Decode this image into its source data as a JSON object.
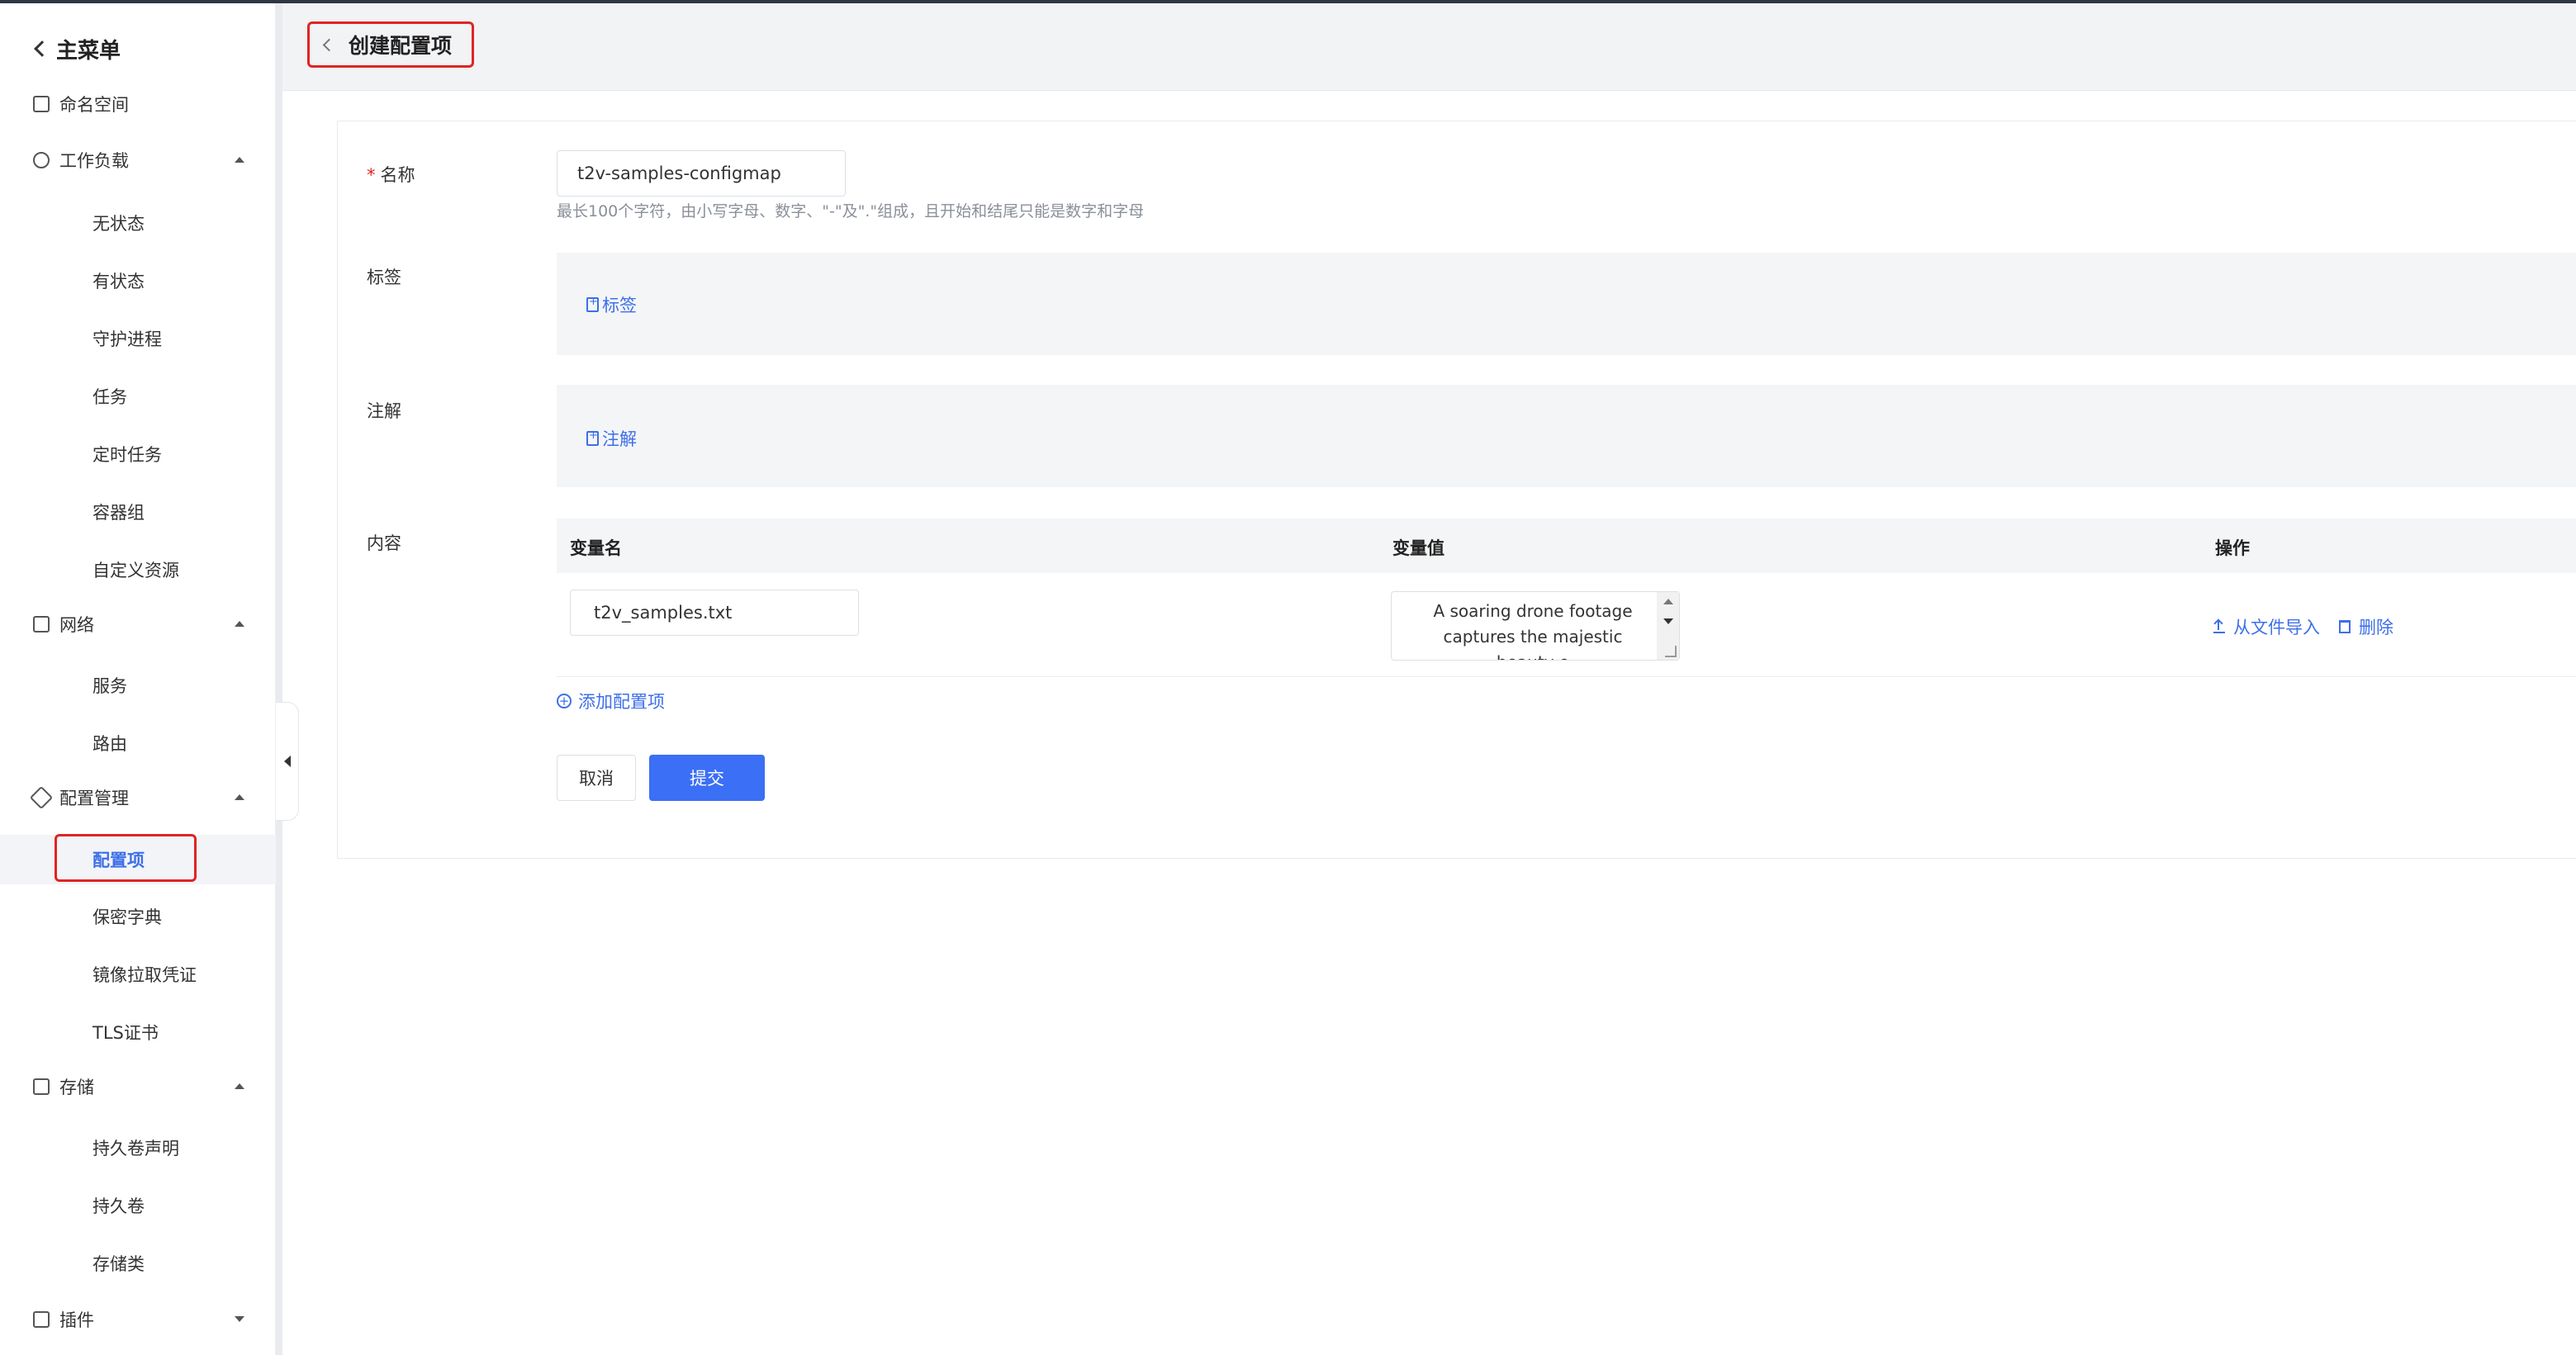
{
  "sidebar": {
    "back_label": "主菜单",
    "groups": [
      {
        "label": "命名空间",
        "icon": "namespace-icon"
      },
      {
        "label": "工作负载",
        "icon": "workload-icon"
      },
      {
        "label": "网络",
        "icon": "network-icon"
      },
      {
        "label": "配置管理",
        "icon": "config-icon"
      },
      {
        "label": "存储",
        "icon": "storage-icon"
      },
      {
        "label": "插件",
        "icon": "plugin-icon"
      }
    ],
    "workload_items": [
      "无状态",
      "有状态",
      "守护进程",
      "任务",
      "定时任务",
      "容器组",
      "自定义资源"
    ],
    "network_items": [
      "服务",
      "路由"
    ],
    "config_items": [
      "配置项",
      "保密字典",
      "镜像拉取凭证",
      "TLS证书"
    ],
    "storage_items": [
      "持久卷声明",
      "持久卷",
      "存储类"
    ],
    "active_item": "配置项"
  },
  "header": {
    "title": "创建配置项"
  },
  "form": {
    "name_label": "名称",
    "name_value": "t2v-samples-configmap",
    "name_hint": "最长100个字符，由小写字母、数字、\"-\"及\".\"组成，且开始和结尾只能是数字和字母",
    "labels_label": "标签",
    "labels_add": "标签",
    "annotations_label": "注解",
    "annotations_add": "注解",
    "content_label": "内容",
    "table": {
      "col_key": "变量名",
      "col_value": "变量值",
      "col_ops": "操作",
      "rows": [
        {
          "key": "t2v_samples.txt",
          "value": "A soaring drone footage captures the majestic beauty o",
          "import_label": "从文件导入",
          "delete_label": "删除"
        }
      ]
    },
    "add_config_label": "添加配置项",
    "cancel_label": "取消",
    "submit_label": "提交"
  }
}
